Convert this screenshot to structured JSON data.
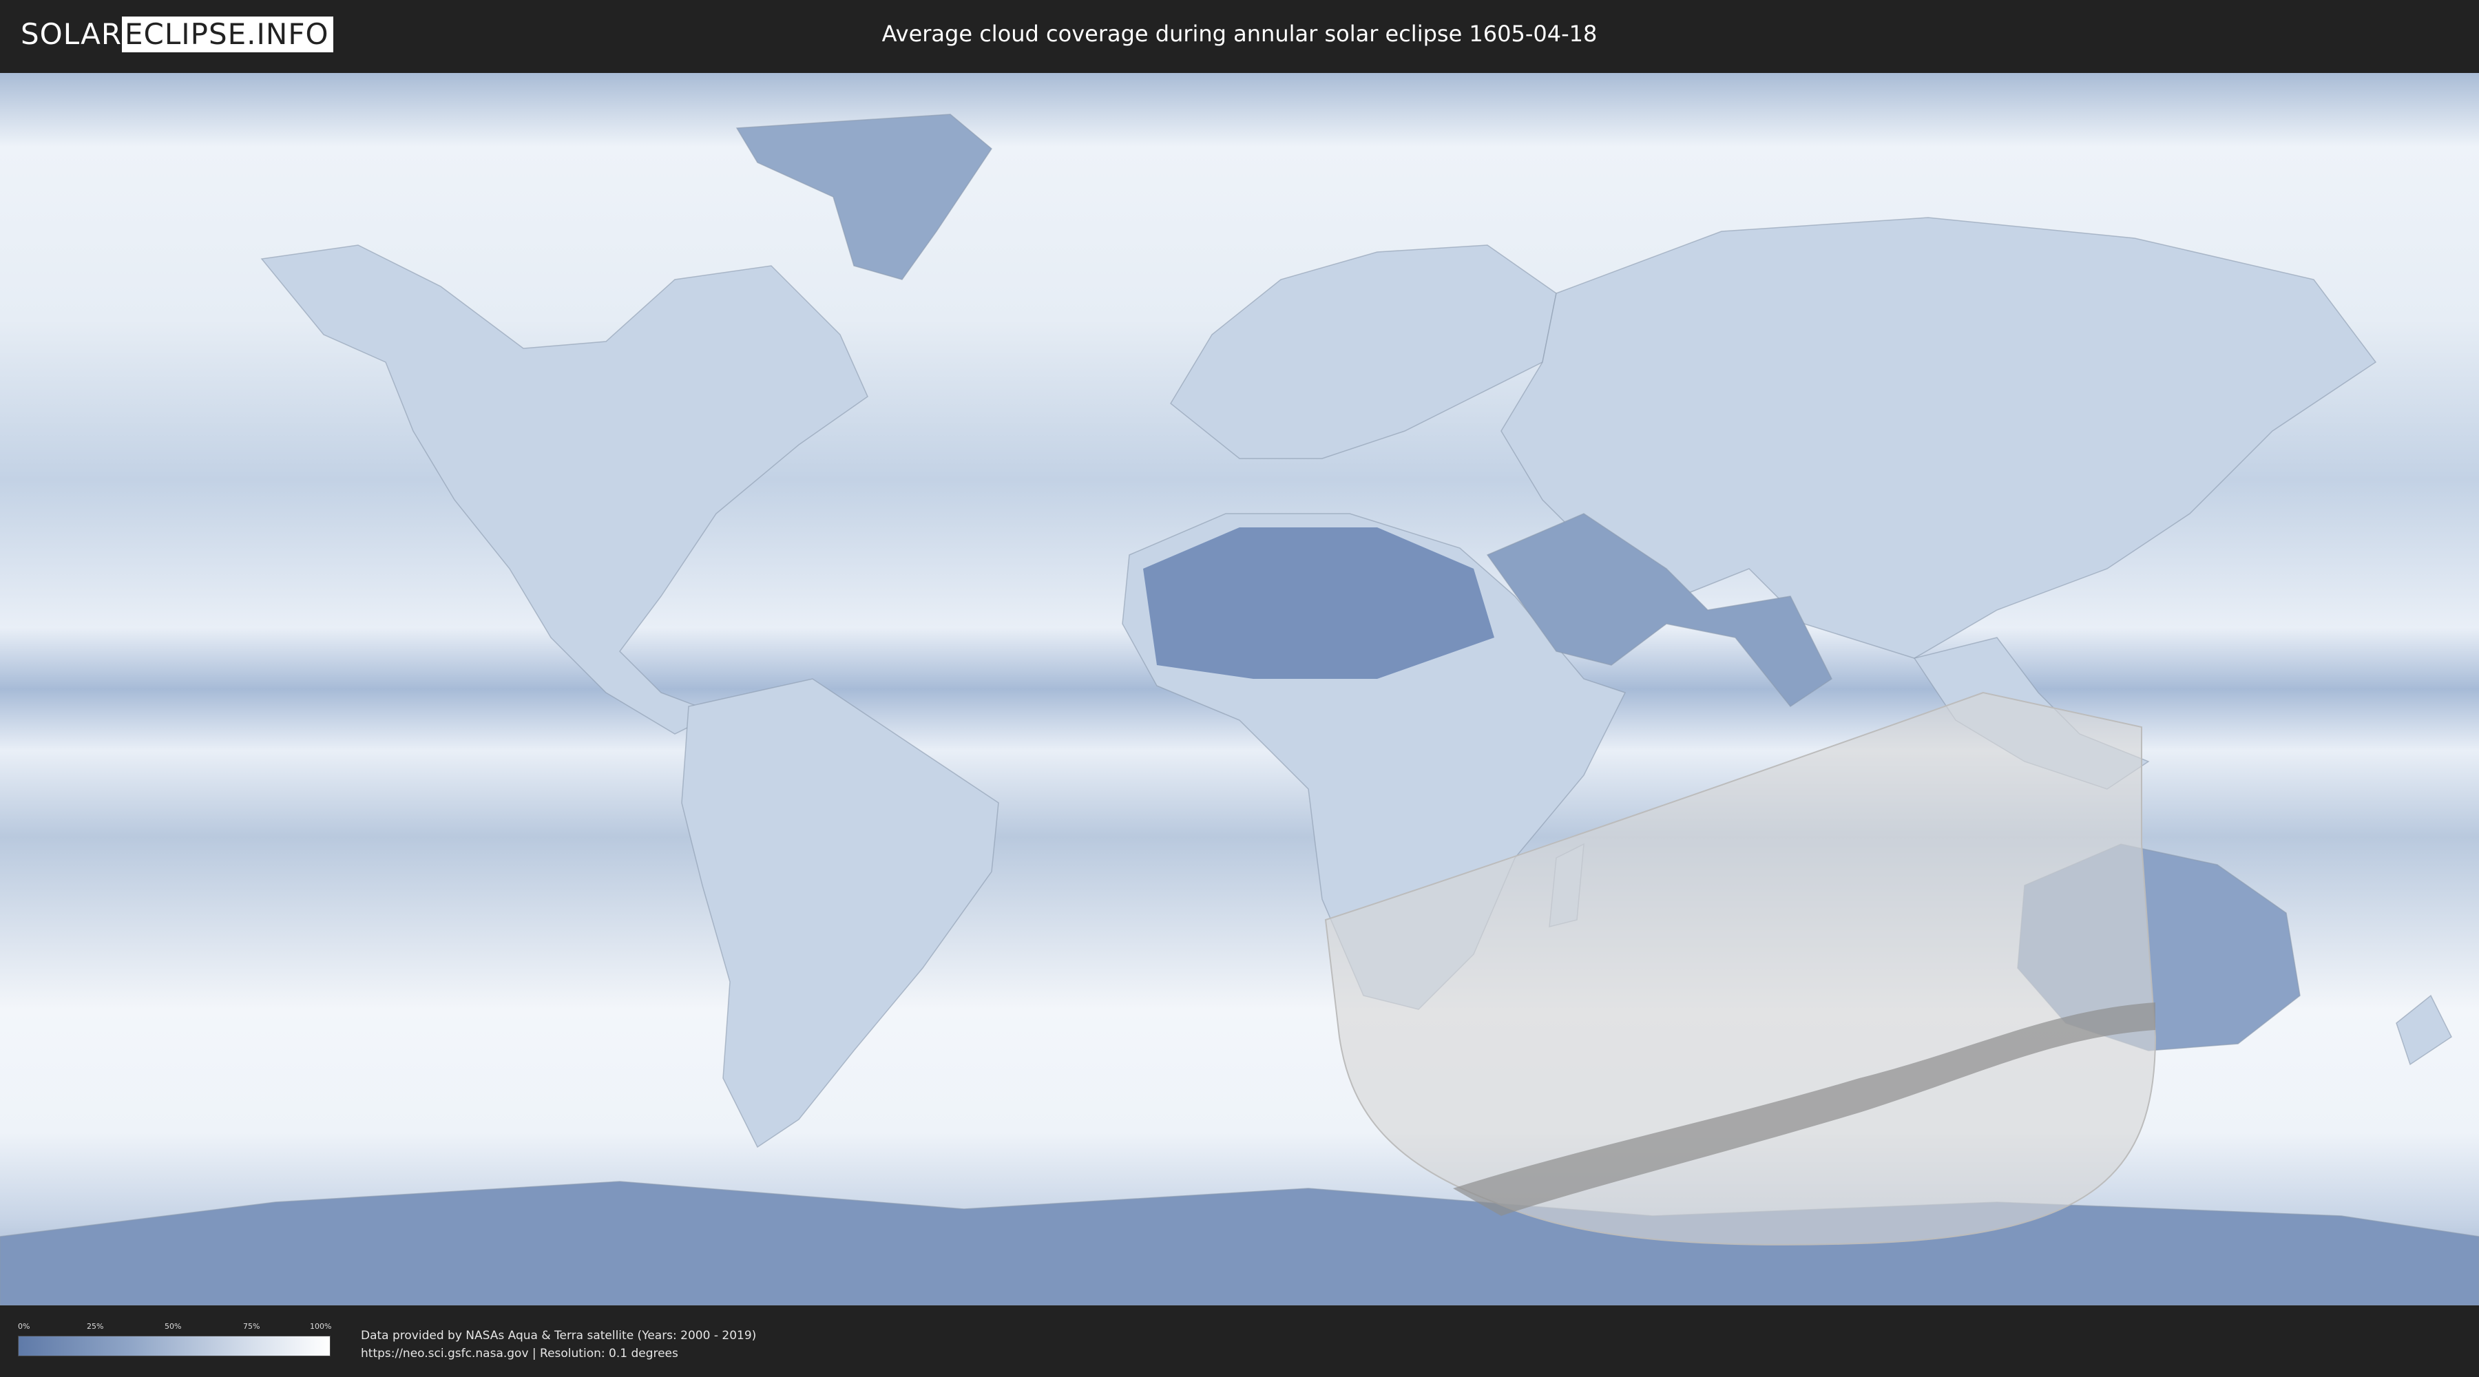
{
  "header": {
    "logo_left": "SOLAR",
    "logo_right": "ECLIPSE.INFO",
    "title": "Average cloud coverage during annular solar eclipse 1605-04-18"
  },
  "legend": {
    "ticks": [
      "0%",
      "25%",
      "50%",
      "75%",
      "100%"
    ],
    "colors": {
      "low": "#5f7aa8",
      "mid": "#d6dfec",
      "high": "#ffffff"
    }
  },
  "footer": {
    "credit_line1": "Data provided by NASAs Aqua & Terra satellite (Years: 2000 - 2019)",
    "credit_line2": "https://neo.sci.gsfc.nasa.gov | Resolution: 0.1 degrees"
  },
  "map": {
    "projection": "equirectangular",
    "colors": {
      "ocean_cloudy": "#e4ebf4",
      "land_clear": "#6e89b5",
      "eclipse_overlay": "#d9d9d9",
      "central_path": "#9a9a9a"
    }
  }
}
